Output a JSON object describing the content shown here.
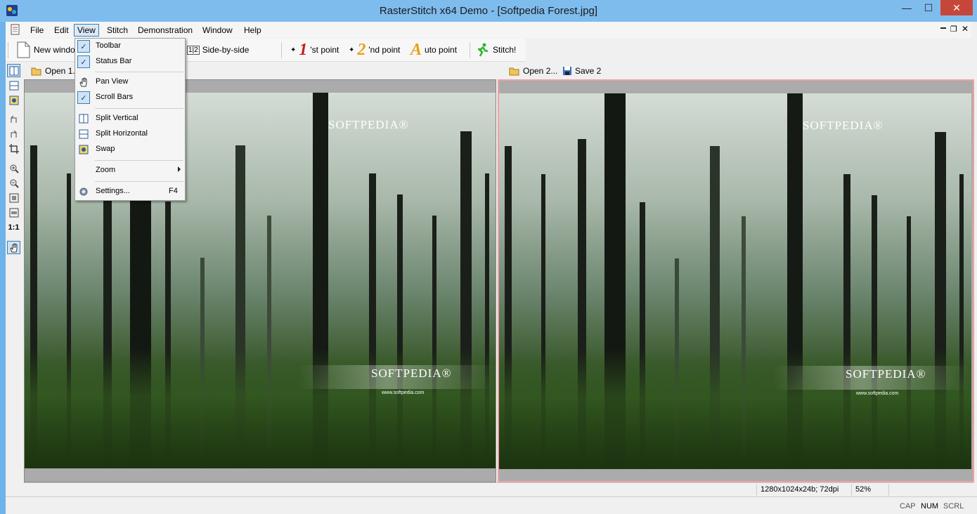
{
  "window": {
    "title": "RasterStitch x64 Demo - [Softpedia Forest.jpg]",
    "min_glyph": "—",
    "max_glyph": "☐",
    "close_glyph": "✕"
  },
  "menubar": {
    "items": [
      {
        "label": "File"
      },
      {
        "label": "Edit"
      },
      {
        "label": "View"
      },
      {
        "label": "Stitch"
      },
      {
        "label": "Demonstration"
      },
      {
        "label": "Window"
      },
      {
        "label": "Help"
      }
    ],
    "active": "View",
    "mdi_restore_glyph": "❐",
    "mdi_close_glyph": "✕"
  },
  "toolbar": {
    "new_window": "New windo",
    "side_by_side": "Side-by-side",
    "side_by_side_icon_text": "1|2",
    "first_point": "'st point",
    "first_point_num": "1",
    "second_point": "'nd point",
    "second_point_num": "2",
    "auto_point": "uto point",
    "auto_point_letter": "A",
    "stitch": "Stitch!"
  },
  "vtoolbar": {
    "one_to_one": "1:1"
  },
  "pane_left": {
    "open_label": "Open 1..."
  },
  "pane_right": {
    "open_label": "Open 2...",
    "save_label": "Save 2"
  },
  "watermark": {
    "brand": "SOFTPEDIA®",
    "url": "www.softpedia.com"
  },
  "status": {
    "image_info": "1280x1024x24b; 72dpi",
    "zoom": "52%",
    "cap": "CAP",
    "num": "NUM",
    "scrl": "SCRL"
  },
  "view_menu": {
    "items": [
      {
        "label": "Toolbar",
        "checked": true
      },
      {
        "label": "Status Bar",
        "checked": true
      },
      {
        "label": "Pan View",
        "checked": false
      },
      {
        "label": "Scroll Bars",
        "checked": true
      },
      {
        "label": "Split Vertical",
        "checked": false
      },
      {
        "label": "Split Horizontal",
        "checked": false
      },
      {
        "label": "Swap",
        "checked": false
      },
      {
        "label": "Zoom",
        "submenu": true
      },
      {
        "label": "Settings...",
        "shortcut": "F4"
      }
    ],
    "check_glyph": "✓"
  },
  "colors": {
    "titlebar": "#7fbcee",
    "close_button": "#c7463a",
    "selection_border": "#3c7fb1",
    "active_pane_border": "#f0a0a0"
  }
}
